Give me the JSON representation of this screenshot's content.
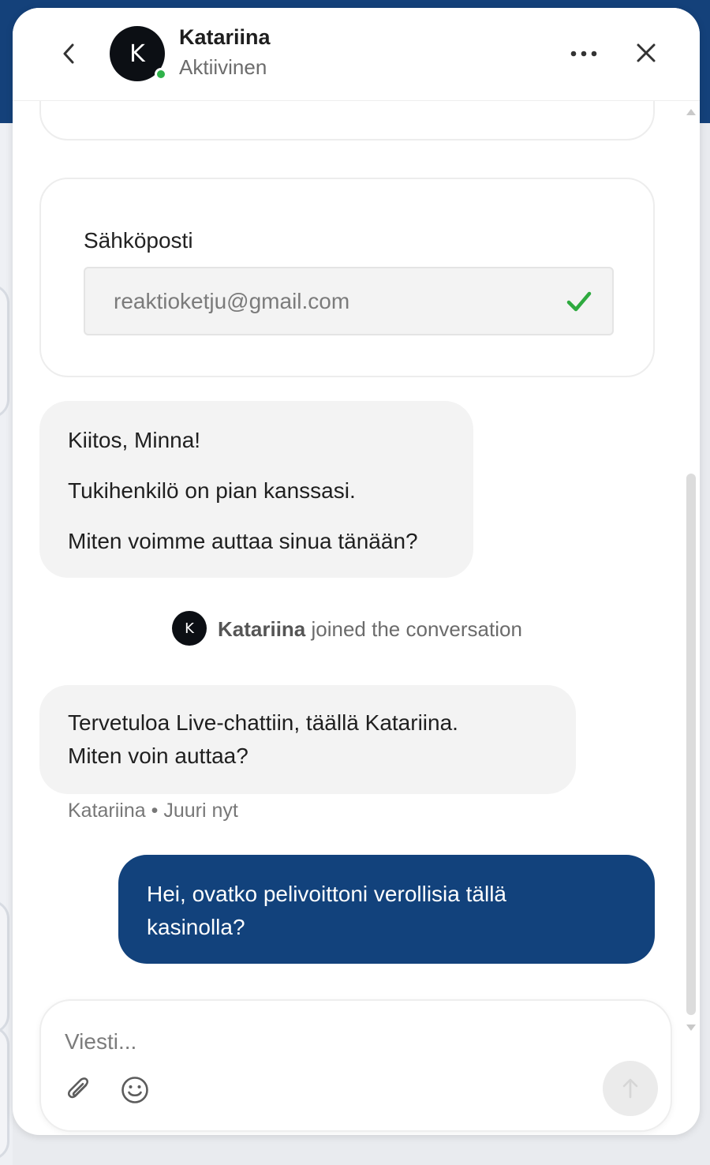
{
  "header": {
    "agent_initial": "K",
    "agent_name": "Katariina",
    "agent_status": "Aktiivinen",
    "status_color": "#2fb24a"
  },
  "email_card": {
    "label": "Sähköposti",
    "value": "reaktioketju@gmail.com",
    "check_color": "#2eaa3f"
  },
  "messages": [
    {
      "from": "bot",
      "lines": [
        "Kiitos, Minna!",
        "Tukihenkilö on pian kanssasi.",
        "Miten voimme auttaa sinua tänään?"
      ]
    },
    {
      "from": "system",
      "initial": "K",
      "agent": "Katariina",
      "text": "joined the conversation"
    },
    {
      "from": "agent",
      "lines": [
        "Tervetuloa Live-chattiin, täällä Katariina.",
        "Miten voin auttaa?"
      ],
      "meta": "Katariina • Juuri nyt"
    },
    {
      "from": "user",
      "lines": [
        "Hei, ovatko pelivoittoni verollisia tällä",
        "kasinolla?"
      ],
      "color": "#12427c"
    }
  ],
  "composer": {
    "placeholder": "Viesti..."
  },
  "icons": {
    "back": "chevron-left-icon",
    "more": "more-horizontal-icon",
    "close": "close-icon",
    "check": "check-icon",
    "attach": "paperclip-icon",
    "emoji": "smiley-icon",
    "send": "arrow-up-icon"
  }
}
